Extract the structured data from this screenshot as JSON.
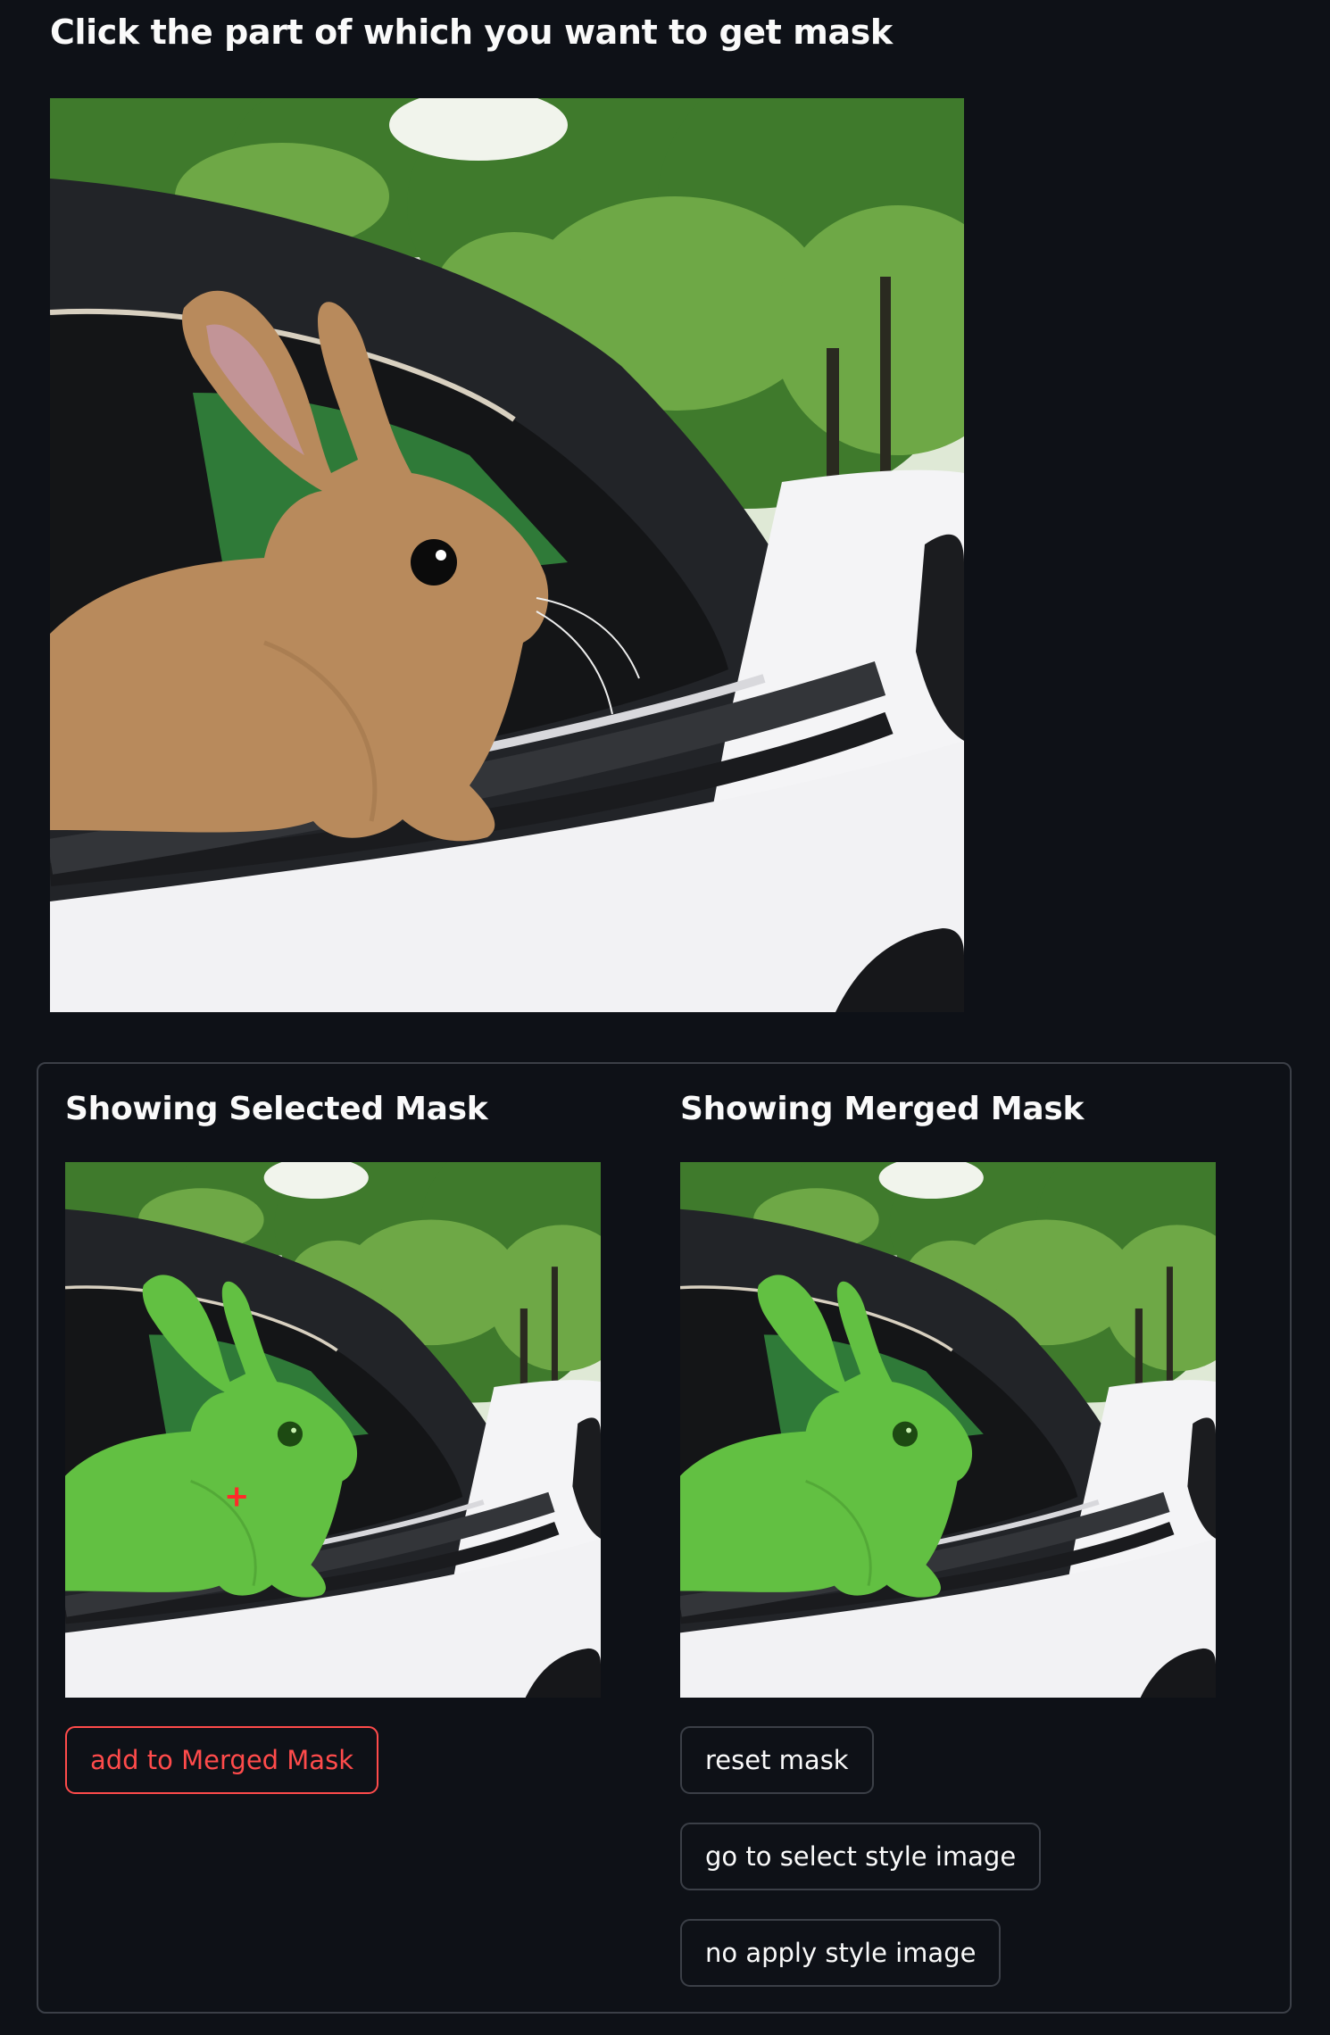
{
  "header": {
    "title": "Click the part of which you want to get mask"
  },
  "main_image": {
    "subject": "rabbit in car window"
  },
  "selected_column": {
    "title": "Showing Selected Mask",
    "add_button": "add to Merged Mask"
  },
  "merged_column": {
    "title": "Showing Merged Mask",
    "reset_button": "reset mask",
    "style_button": "go to select style image",
    "no_style_button": "no apply style image"
  },
  "colors": {
    "background": "#0e1117",
    "text": "#fafafa",
    "accent": "#ff4b4b",
    "border": "#3b3f47",
    "mask_overlay": "#6ee04a",
    "click_marker": "#ff2a2a"
  },
  "icons": {
    "click_marker": "plus-marker-icon"
  }
}
